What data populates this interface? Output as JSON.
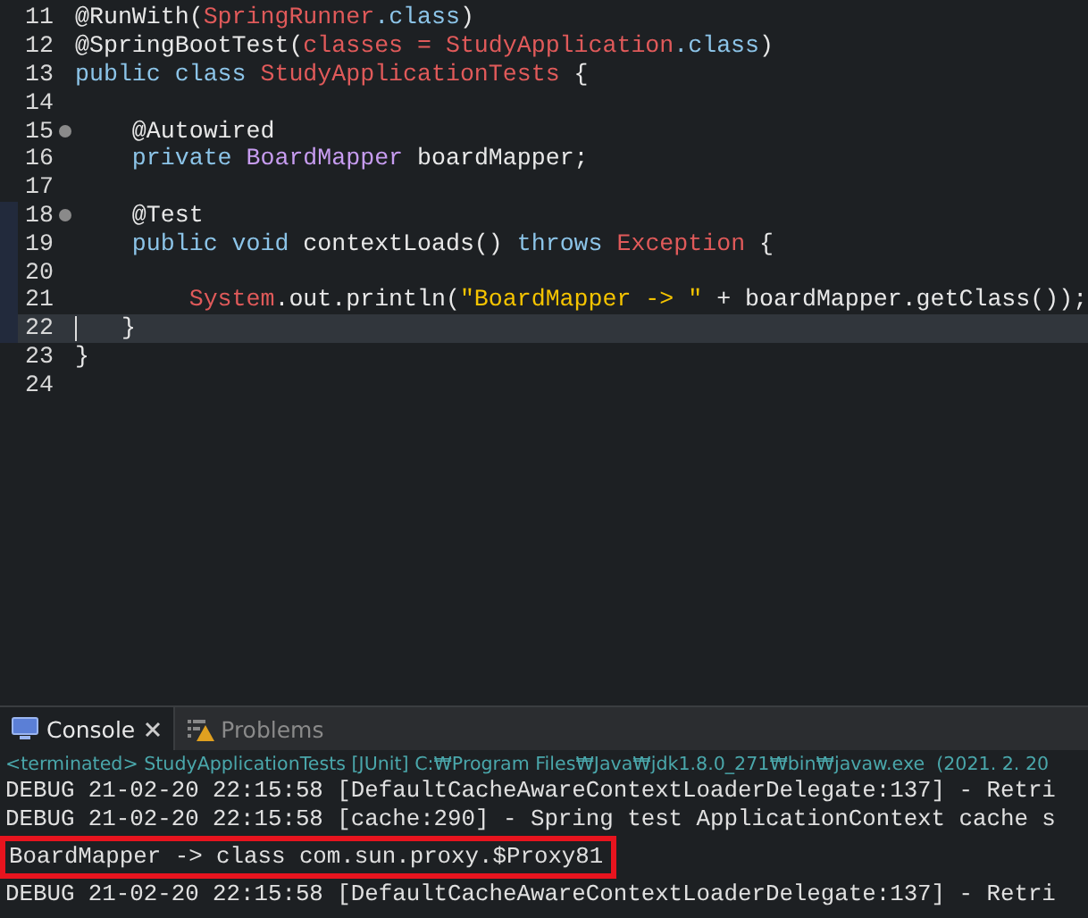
{
  "editor": {
    "lines": [
      {
        "number": "11",
        "fold": false,
        "in_range": false,
        "current": false,
        "tokens": [
          {
            "kind": "annotation",
            "text": "@RunWith("
          },
          {
            "kind": "type",
            "text": "SpringRunner"
          },
          {
            "kind": "keyword",
            "text": ".class"
          },
          {
            "kind": "plain",
            "text": ")"
          }
        ]
      },
      {
        "number": "12",
        "fold": false,
        "in_range": false,
        "current": false,
        "tokens": [
          {
            "kind": "annotation",
            "text": "@SpringBootTest("
          },
          {
            "kind": "type",
            "text": "classes = StudyApplication"
          },
          {
            "kind": "keyword",
            "text": ".class"
          },
          {
            "kind": "plain",
            "text": ")"
          }
        ]
      },
      {
        "number": "13",
        "fold": false,
        "in_range": false,
        "current": false,
        "tokens": [
          {
            "kind": "keyword",
            "text": "public class "
          },
          {
            "kind": "type",
            "text": "StudyApplicationTests"
          },
          {
            "kind": "plain",
            "text": " {"
          }
        ]
      },
      {
        "number": "14",
        "fold": false,
        "in_range": false,
        "current": false
      },
      {
        "number": "15",
        "fold": true,
        "in_range": false,
        "current": false,
        "tokens": [
          {
            "kind": "annotation",
            "text": "    @Autowired"
          }
        ]
      },
      {
        "number": "16",
        "fold": false,
        "in_range": false,
        "current": false,
        "tokens": [
          {
            "kind": "keyword",
            "text": "    private "
          },
          {
            "kind": "field_type",
            "text": "BoardMapper"
          },
          {
            "kind": "plain",
            "text": " boardMapper;"
          }
        ]
      },
      {
        "number": "17",
        "fold": false,
        "in_range": false,
        "current": false
      },
      {
        "number": "18",
        "fold": true,
        "in_range": true,
        "current": false,
        "tokens": [
          {
            "kind": "annotation",
            "text": "    @Test"
          }
        ]
      },
      {
        "number": "19",
        "fold": false,
        "in_range": true,
        "current": false,
        "tokens": [
          {
            "kind": "keyword",
            "text": "    public void "
          },
          {
            "kind": "plain",
            "text": "contextLoads() "
          },
          {
            "kind": "keyword",
            "text": "throws "
          },
          {
            "kind": "type",
            "text": "Exception"
          },
          {
            "kind": "plain",
            "text": " {"
          }
        ]
      },
      {
        "number": "20",
        "fold": false,
        "in_range": true,
        "current": false
      },
      {
        "number": "21",
        "fold": false,
        "in_range": true,
        "current": false,
        "tokens": [
          {
            "kind": "type",
            "text": "        System"
          },
          {
            "kind": "plain",
            "text": ".out.println("
          },
          {
            "kind": "string",
            "text": "\"BoardMapper -> \""
          },
          {
            "kind": "plain",
            "text": " + boardMapper.getClass());"
          }
        ]
      },
      {
        "number": "22",
        "fold": false,
        "in_range": true,
        "current": true,
        "tokens": [
          {
            "kind": "plain",
            "text": "   }"
          }
        ]
      },
      {
        "number": "23",
        "fold": false,
        "in_range": false,
        "current": false,
        "tokens": [
          {
            "kind": "plain",
            "text": "}"
          }
        ]
      },
      {
        "number": "24",
        "fold": false,
        "in_range": false,
        "current": false
      }
    ]
  },
  "panel": {
    "tabs": [
      {
        "label": "Console",
        "selected": true,
        "kind": "console"
      },
      {
        "label": "Problems",
        "selected": false,
        "kind": "problems"
      }
    ],
    "status": "<terminated> StudyApplicationTests [JUnit] C:₩Program Files₩Java₩jdk1.8.0_271₩bin₩javaw.exe  (2021. 2. 20",
    "lines": [
      {
        "text": "DEBUG 21-02-20 22:15:58 [DefaultCacheAwareContextLoaderDelegate:137] - Retri",
        "highlighted": false
      },
      {
        "text": "DEBUG 21-02-20 22:15:58 [cache:290] - Spring test ApplicationContext cache s",
        "highlighted": false
      },
      {
        "text": "BoardMapper -> class com.sun.proxy.$Proxy81",
        "highlighted": true
      },
      {
        "text": "DEBUG 21-02-20 22:15:58 [DefaultCacheAwareContextLoaderDelegate:137] - Retri",
        "highlighted": false
      }
    ]
  }
}
